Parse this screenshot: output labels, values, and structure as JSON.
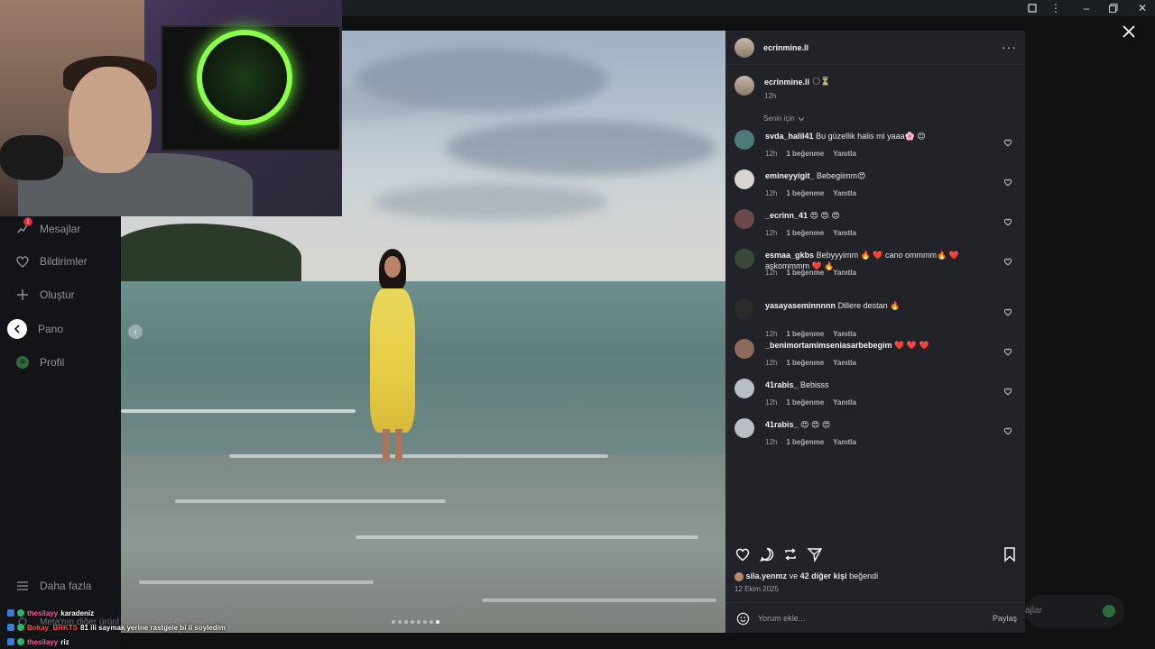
{
  "sidebar": {
    "items": [
      {
        "label": "Mesajlar",
        "icon": "messenger-icon",
        "badge": "1"
      },
      {
        "label": "Bildirimler",
        "icon": "heart-icon"
      },
      {
        "label": "Oluştur",
        "icon": "plus-icon"
      },
      {
        "label": "Pano",
        "icon": "dashboard-icon"
      },
      {
        "label": "Profil",
        "icon": "profile-icon"
      }
    ],
    "more_label": "Daha fazla",
    "meta_label": "Meta'nın diğer ürünl"
  },
  "post": {
    "author": "ecrinmine.ll",
    "caption_emoji": "🌕⏳",
    "caption_time": "12h",
    "sort_label": "Senin için",
    "comments": [
      {
        "user": "svda_halil41",
        "text": "Bu güzellik halis mi yaaa🌸 😊",
        "time": "12h",
        "likes": "1 beğenme",
        "reply": "Yanıtla"
      },
      {
        "user": "emineyyigit_",
        "text": "Bebegiimm😍",
        "time": "12h",
        "likes": "1 beğenme",
        "reply": "Yanıtla"
      },
      {
        "user": "_ecrinn_41",
        "text": "😍 😍 😍",
        "time": "12h",
        "likes": "1 beğenme",
        "reply": "Yanıtla"
      },
      {
        "user": "esmaa_gkbs",
        "text": "Bebyyyimm 🔥 ❤️ cano ommmm🔥 ❤️ aşkommmm ❤️ 🔥",
        "time": "12h",
        "likes": "1 beğenme",
        "reply": "Yanıtla"
      },
      {
        "user": "yasayaseminnnnn",
        "text": "Dillere destan 🔥",
        "time": "12h",
        "likes": "1 beğenme",
        "reply": "Yanıtla"
      },
      {
        "user": "_benimortamimseniasarbebegim",
        "text": "❤️ ❤️ ❤️",
        "time": "12h",
        "likes": "1 beğenme",
        "reply": "Yanıtla"
      },
      {
        "user": "41rabis_",
        "text": "Bebisss",
        "time": "12h",
        "likes": "1 beğenme",
        "reply": "Yanıtla"
      },
      {
        "user": "41rabis_",
        "text": "😍 😍 😍",
        "time": "12h",
        "likes": "1 beğenme",
        "reply": "Yanıtla"
      }
    ],
    "liked_by_user": "sila.yenmz",
    "liked_by_conj": "ve",
    "liked_by_others": "42 diğer kişi",
    "liked_by_suffix": "beğendi",
    "date": "12 Ekim 2025",
    "comment_placeholder": "Yorum ekle...",
    "share_label": "Paylaş",
    "carousel_count": 8,
    "carousel_active": 7
  },
  "ghost_input_label": "ajlar",
  "chat": [
    {
      "user": "thesilayy",
      "msg": "karadeniz",
      "color": "pink"
    },
    {
      "user": "Bokay_BRKTS",
      "msg": "81 ili saymak yerine rastgele bi il soyledim",
      "color": "red"
    },
    {
      "user": "thesilayy",
      "msg": "riz",
      "color": "pink"
    }
  ],
  "colors": {
    "panel_bg": "#212328",
    "page_bg": "#0f1113",
    "dress_yellow": "#e9d75b",
    "ring_green": "#8cff4a"
  }
}
